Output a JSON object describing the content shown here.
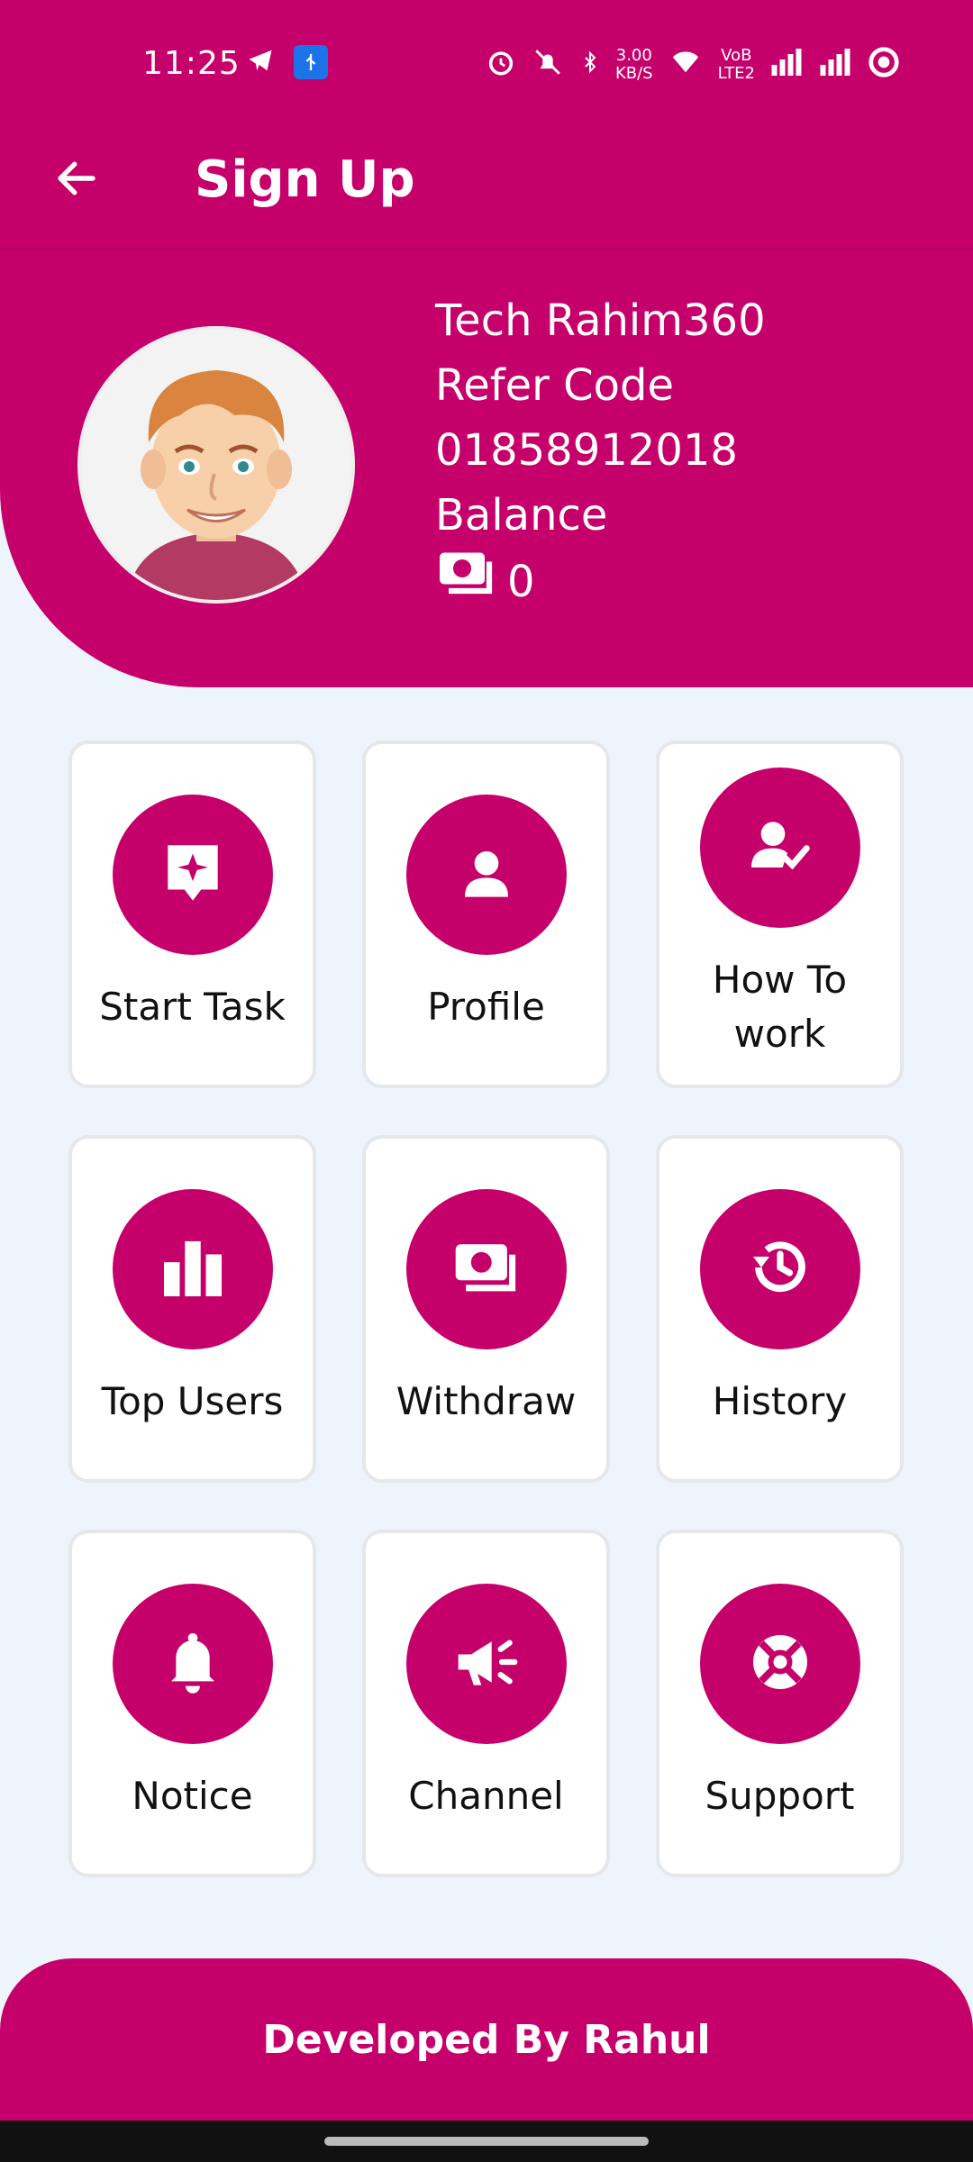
{
  "status_bar": {
    "time": "11:25",
    "speed_value": "3.00",
    "speed_unit": "KB/S",
    "network_label_top": "VoB",
    "network_label_bottom": "LTE2"
  },
  "app_bar": {
    "title": "Sign Up",
    "back_icon": "arrow-left-icon"
  },
  "profile": {
    "name": "Tech Rahim360",
    "refer_label": "Refer Code",
    "refer_code": "01858912018",
    "balance_label": "Balance",
    "balance_value": "0",
    "balance_icon": "money-icon"
  },
  "tiles": [
    {
      "label": "Start Task",
      "icon": "sparkle-message-icon"
    },
    {
      "label": "Profile",
      "icon": "person-icon"
    },
    {
      "label": "How To work",
      "icon": "user-check-icon"
    },
    {
      "label": "Top Users",
      "icon": "bar-chart-icon"
    },
    {
      "label": "Withdraw",
      "icon": "money-icon"
    },
    {
      "label": "History",
      "icon": "history-icon"
    },
    {
      "label": "Notice",
      "icon": "bell-icon"
    },
    {
      "label": "Channel",
      "icon": "megaphone-icon"
    },
    {
      "label": "Support",
      "icon": "lifebuoy-icon"
    }
  ],
  "footer": {
    "text": "Developed By Rahul"
  },
  "colors": {
    "brand": "#c6006b",
    "background": "#eef4fb",
    "tile_border": "#e5e7ea"
  }
}
